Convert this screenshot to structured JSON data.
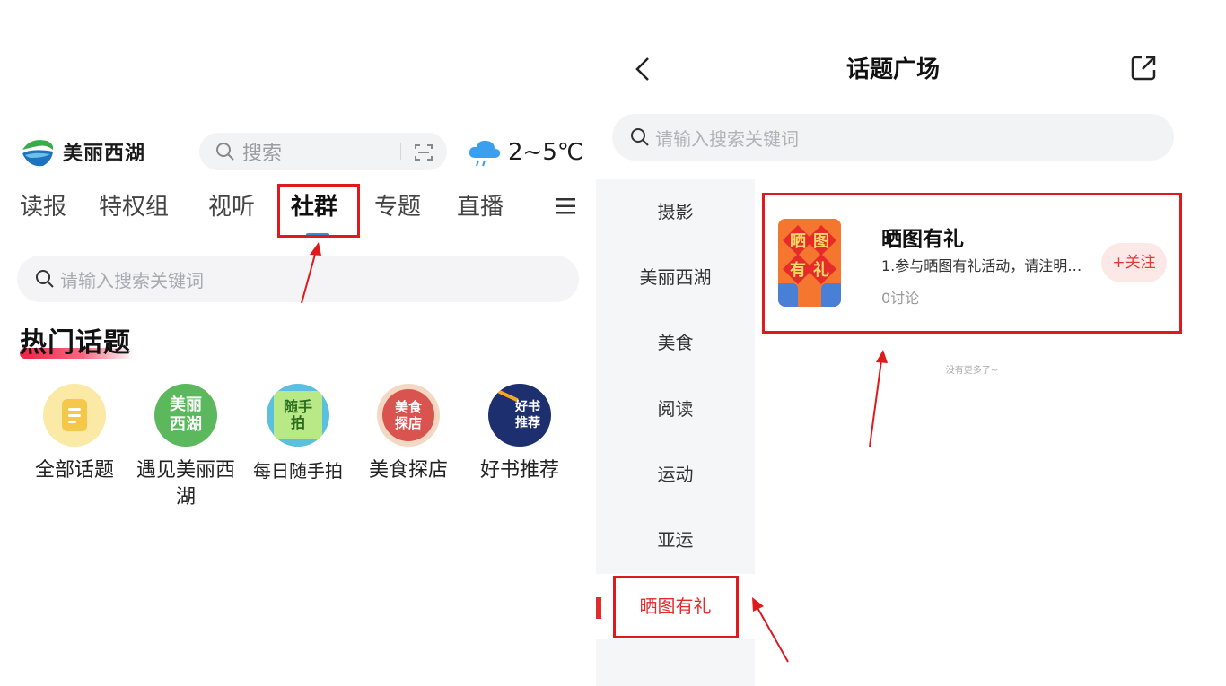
{
  "left": {
    "brand": {
      "name": "美丽西湖"
    },
    "search": {
      "placeholder": "搜索"
    },
    "weather": {
      "temperature": "2~5℃"
    },
    "tabs": [
      {
        "label": "读报"
      },
      {
        "label": "特权组"
      },
      {
        "label": "视听"
      },
      {
        "label": "社群",
        "active": true
      },
      {
        "label": "专题"
      },
      {
        "label": "直播"
      }
    ],
    "search2": {
      "placeholder": "请输入搜索关键词"
    },
    "hot_topics": {
      "title": "热门话题",
      "items": [
        {
          "label": "全部话题",
          "icon": "document-icon",
          "icon_text": ""
        },
        {
          "label": "遇见美丽西湖",
          "icon": "meili-xihu-icon",
          "icon_text": "美丽西湖"
        },
        {
          "label": "每日随手拍",
          "icon": "suishoupai-icon",
          "icon_text": "随手拍"
        },
        {
          "label": "美食探店",
          "icon": "meishi-tandian-icon",
          "icon_text": "美食探店"
        },
        {
          "label": "好书推荐",
          "icon": "haoshu-tuijian-icon",
          "icon_text": "好书推荐"
        }
      ]
    }
  },
  "right": {
    "title": "话题广场",
    "search": {
      "placeholder": "请输入搜索关键词"
    },
    "sidebar": [
      {
        "label": "摄影"
      },
      {
        "label": "美丽西湖"
      },
      {
        "label": "美食"
      },
      {
        "label": "阅读"
      },
      {
        "label": "运动"
      },
      {
        "label": "亚运"
      },
      {
        "label": "晒图有礼",
        "active": true
      }
    ],
    "card": {
      "title": "晒图有礼",
      "description": "1.参与晒图有礼活动，请注明…",
      "discussions": "0讨论",
      "follow_label": "+关注",
      "thumbnail_text": [
        "晒",
        "图",
        "有",
        "礼"
      ]
    },
    "end_text": "没有更多了~"
  },
  "colors": {
    "accent_red": "#e0191c",
    "tab_indicator": "#2e8fd6",
    "follow_bg": "#fde8e8"
  }
}
